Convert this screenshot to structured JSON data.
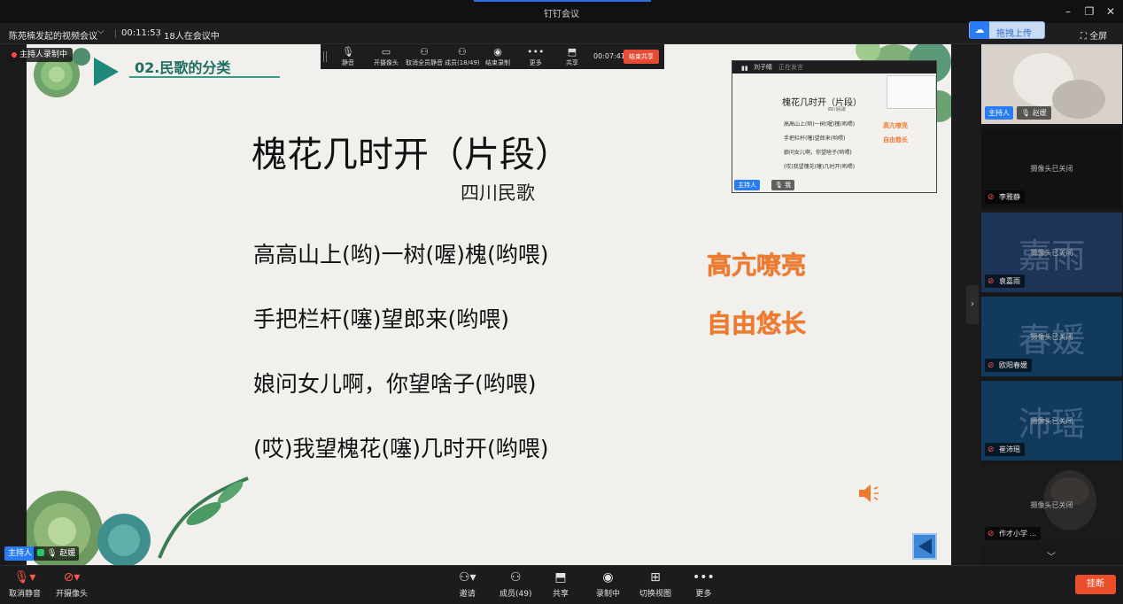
{
  "window": {
    "title": "钉钉会议",
    "controls": [
      "minimize-icon",
      "restore-icon",
      "close-icon"
    ]
  },
  "meeting": {
    "name": "陈苑楠发起的视频会议",
    "elapsed": "00:11:53",
    "participants_text": "18人在会议中",
    "upload_label": "拖拽上传",
    "fullscreen_label": "全屏",
    "recording_badge": "主持人录制中"
  },
  "float_toolbar": {
    "items": [
      {
        "label": "静音",
        "icon": "mic-icon"
      },
      {
        "label": "开摄像头",
        "icon": "camera-icon"
      },
      {
        "label": "取消全员静音",
        "icon": "users-mute-icon"
      },
      {
        "label": "成员(18/49)",
        "icon": "users-icon"
      },
      {
        "label": "结束录制",
        "icon": "record-icon"
      },
      {
        "label": "更多",
        "icon": "more-icon"
      },
      {
        "label": "共享",
        "icon": "share-icon"
      }
    ],
    "time": "00:07:41",
    "end_share_label": "结束共享"
  },
  "slide": {
    "section_title": "02.民歌的分类",
    "song_title": "槐花几时开（片段）",
    "song_origin": "四川民歌",
    "lyrics": [
      "高高山上(哟)一树(喔)槐(哟喂)",
      "手把栏杆(噻)望郎来(哟喂)",
      "娘问女儿啊，你望啥子(哟喂)",
      "(哎)我望槐花(噻)几时开(哟喂)"
    ],
    "tags": [
      "高亢嘹亮",
      "自由悠长"
    ],
    "speaker_icon": "speaker-icon",
    "prev_icon": "prev-arrow-icon"
  },
  "self_view": {
    "name": "刘子睛",
    "status": "正在发言",
    "title": "槐花几时开（片段）",
    "origin": "四川民歌",
    "lines": [
      "高高山上(哟)一树(喔)槐(哟喂)",
      "手把栏杆(噻)望郎来(哟喂)",
      "娘问女儿啊，你望啥子(哟喂)",
      "(哎)我望槐花(噻)几时开(哟喂)"
    ],
    "tags": [
      "高亢嘹亮",
      "自由悠长"
    ],
    "host_label": "主持人",
    "me_label": "我"
  },
  "active_speaker": {
    "host_label": "主持人",
    "name": "赵媛"
  },
  "gallery": {
    "cam_off_text": "摄像头已关闭",
    "tiles": [
      {
        "name": "赵媛",
        "host": "主持人",
        "avatar": "",
        "video": true
      },
      {
        "name": "李雅静",
        "avatar": "",
        "video": false
      },
      {
        "name": "袁嘉雨",
        "avatar": "嘉雨",
        "video": false
      },
      {
        "name": "欧阳春媛",
        "avatar": "春媛",
        "video": false
      },
      {
        "name": "崔沛瑶",
        "avatar": "沛瑶",
        "video": false
      },
      {
        "name": "作才小学 ...",
        "avatar": "",
        "video": false
      }
    ]
  },
  "bottom_bar": {
    "left": [
      {
        "label": "取消静音",
        "icon": "mic-muted-icon"
      },
      {
        "label": "开摄像头",
        "icon": "camera-off-icon"
      }
    ],
    "center": [
      {
        "label": "邀请",
        "icon": "invite-icon"
      },
      {
        "label": "成员(49)",
        "icon": "members-icon"
      },
      {
        "label": "共享",
        "icon": "share-icon"
      },
      {
        "label": "录制中",
        "icon": "recording-icon"
      },
      {
        "label": "切换视图",
        "icon": "grid-view-icon"
      },
      {
        "label": "更多",
        "icon": "more-icon"
      }
    ],
    "leave_label": "挂断"
  },
  "colors": {
    "accent": "#2a7cf4",
    "danger": "#ea4e2b",
    "slide_tag": "#f07a2c",
    "section_teal": "#1d6e63"
  }
}
